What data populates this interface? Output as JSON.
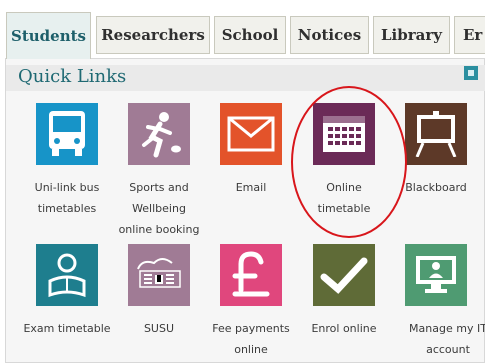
{
  "tabs": [
    {
      "label": "Students"
    },
    {
      "label": "Researchers"
    },
    {
      "label": "School"
    },
    {
      "label": "Notices"
    },
    {
      "label": "Library"
    },
    {
      "label": "Er"
    }
  ],
  "quick_links": {
    "title": "Quick Links",
    "items": [
      {
        "label_lines": [
          "Uni-link bus",
          "timetables"
        ],
        "icon": "bus-icon",
        "color": "#1794c8"
      },
      {
        "label_lines": [
          "Sports and",
          "Wellbeing",
          "online booking"
        ],
        "icon": "runner-icon",
        "color": "#a07b95"
      },
      {
        "label_lines": [
          "Email"
        ],
        "icon": "envelope-icon",
        "color": "#e3532a"
      },
      {
        "label_lines": [
          "Online",
          "timetable"
        ],
        "icon": "calendar-icon",
        "color": "#6b2a57"
      },
      {
        "label_lines": [
          "Blackboard"
        ],
        "icon": "blackboard-icon",
        "color": "#5d3928"
      },
      {
        "label_lines": [
          "Exam timetable"
        ],
        "icon": "reader-icon",
        "color": "#1e7e8e"
      },
      {
        "label_lines": [
          "SUSU"
        ],
        "icon": "susu-logo-icon",
        "color": "#a07b95"
      },
      {
        "label_lines": [
          "Fee payments",
          "online"
        ],
        "icon": "pound-icon",
        "color": "#e0477d"
      },
      {
        "label_lines": [
          "Enrol online"
        ],
        "icon": "checkmark-icon",
        "color": "#5f6b37"
      },
      {
        "label_lines": [
          "Manage my IT",
          "account"
        ],
        "icon": "it-account-icon",
        "color": "#4f9b72"
      }
    ]
  }
}
